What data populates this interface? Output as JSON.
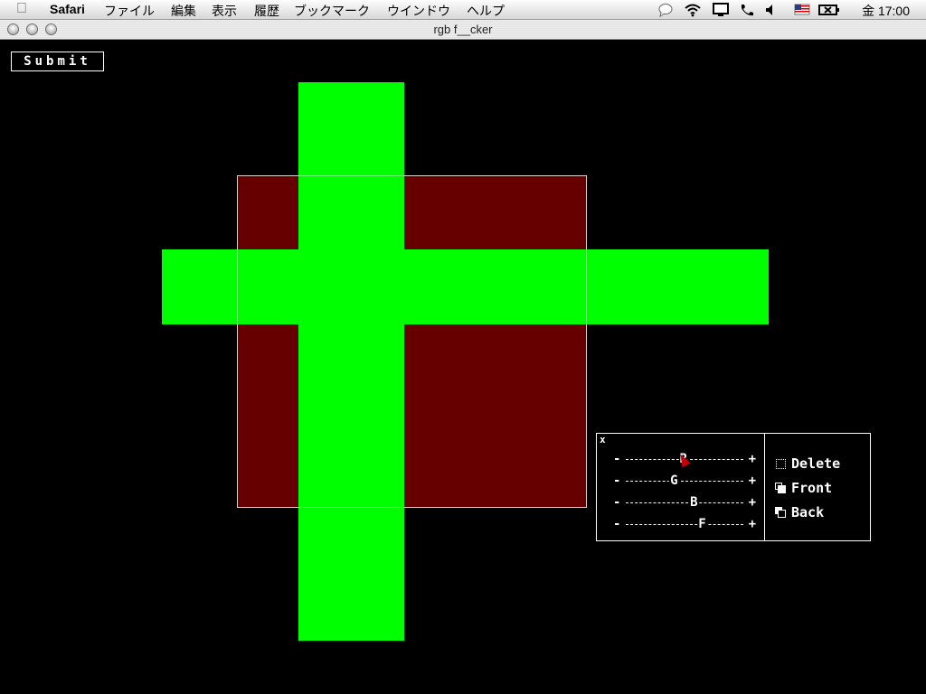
{
  "menubar": {
    "app": "Safari",
    "items": [
      "ファイル",
      "編集",
      "表示",
      "履歴",
      "ブックマーク",
      "ウインドウ",
      "ヘルプ"
    ],
    "clock": "金 17:00"
  },
  "window": {
    "title": "rgb f__cker"
  },
  "toolbar": {
    "submit_label": "Submit"
  },
  "shapes": {
    "red_rect_color": "#660000",
    "green_color": "#00ff00"
  },
  "panel": {
    "close_label": "x",
    "sliders": [
      {
        "label": "R",
        "minus": "-",
        "plus": "+"
      },
      {
        "label": "G",
        "minus": "-",
        "plus": "+"
      },
      {
        "label": "B",
        "minus": "-",
        "plus": "+"
      },
      {
        "label": "F",
        "minus": "-",
        "plus": "+"
      }
    ],
    "actions": {
      "delete": "Delete",
      "front": "Front",
      "back": "Back"
    }
  },
  "icons": {
    "apple": "apple-icon",
    "bubble": "speech-bubble-icon",
    "wifi": "wifi-icon",
    "display": "display-icon",
    "phone": "phone-icon",
    "volume": "volume-icon",
    "flag": "us-flag-icon",
    "battery": "battery-icon"
  }
}
